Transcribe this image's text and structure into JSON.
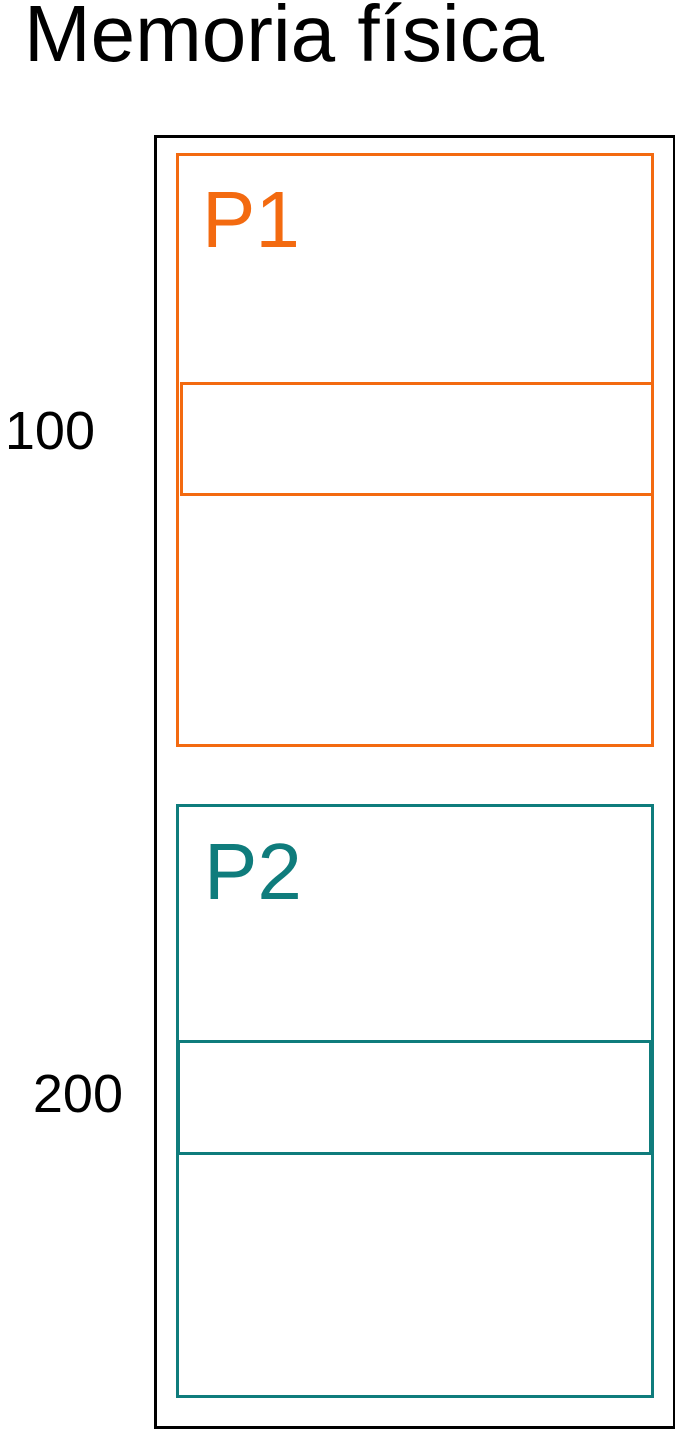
{
  "title": "Memoria física",
  "addresses": {
    "a1": "100",
    "a2": "200"
  },
  "processes": [
    {
      "label": "P1",
      "color": "#f36a10"
    },
    {
      "label": "P2",
      "color": "#0f7c7c"
    }
  ],
  "colors": {
    "memory_border": "#000000",
    "text": "#000000"
  }
}
